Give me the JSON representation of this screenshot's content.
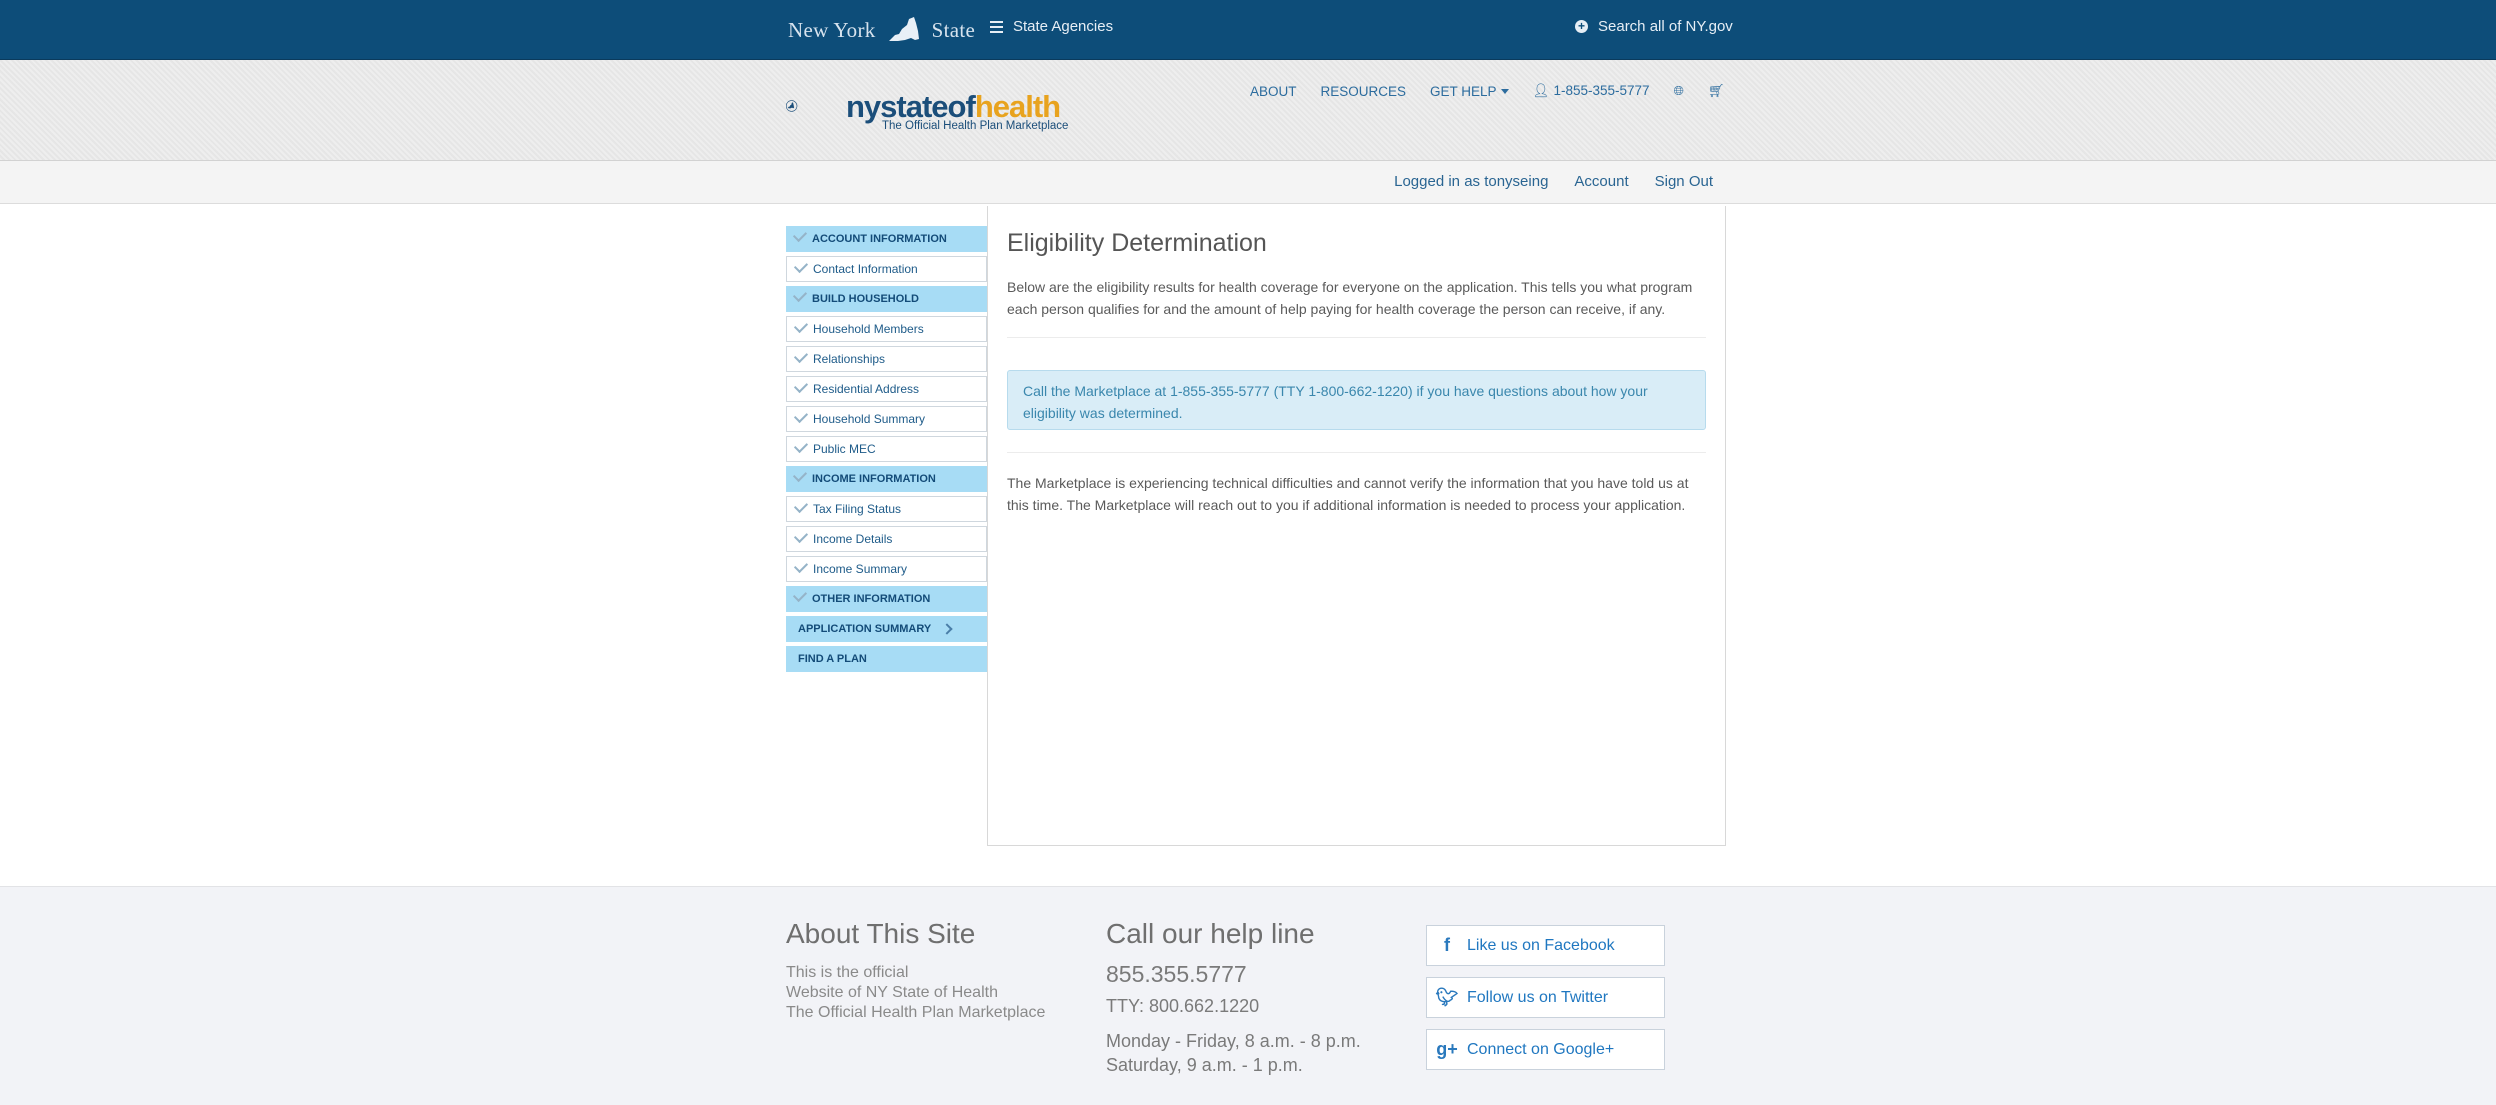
{
  "topbar": {
    "ny_left": "New York",
    "ny_right": "State",
    "agencies": "State Agencies",
    "search": "Search all of NY.gov"
  },
  "logo": {
    "name_part1": "nystateof",
    "name_part2": "health",
    "tagline": "The Official Health Plan Marketplace"
  },
  "nav": {
    "about": "ABOUT",
    "resources": "RESOURCES",
    "get_help": "GET HELP",
    "phone": "1-855-355-5777"
  },
  "account": {
    "logged_in": "Logged in as tonyseing",
    "account": "Account",
    "sign_out": "Sign Out"
  },
  "sidebar": {
    "items": [
      {
        "label": "ACCOUNT INFORMATION"
      },
      {
        "label": "Contact Information"
      },
      {
        "label": "BUILD HOUSEHOLD"
      },
      {
        "label": "Household Members"
      },
      {
        "label": "Relationships"
      },
      {
        "label": "Residential Address"
      },
      {
        "label": "Household Summary"
      },
      {
        "label": "Public MEC"
      },
      {
        "label": "INCOME INFORMATION"
      },
      {
        "label": "Tax Filing Status"
      },
      {
        "label": "Income Details"
      },
      {
        "label": "Income Summary"
      },
      {
        "label": "OTHER INFORMATION"
      },
      {
        "label": "APPLICATION SUMMARY"
      },
      {
        "label": "FIND A PLAN"
      }
    ]
  },
  "main": {
    "title": "Eligibility Determination",
    "intro": "Below are the eligibility results for health coverage for everyone on the application. This tells you what program each person qualifies for and the amount of help paying for health coverage the person can receive, if any.",
    "alert": "Call the Marketplace at 1-855-355-5777 (TTY 1-800-662-1220) if you have questions about how your eligibility was determined.",
    "note": "The Marketplace is experiencing technical difficulties and cannot verify the information that you have told us at this time. The Marketplace will reach out to you if additional information is needed to process your application."
  },
  "footer": {
    "about_title": "About This Site",
    "about_line1": "This is the official",
    "about_line2": "Website of NY State of Health",
    "about_line3": "The Official Health Plan Marketplace",
    "help_title": "Call our help line",
    "help_phone": "855.355.5777",
    "help_tty": "TTY: 800.662.1220",
    "hours1": "Monday - Friday, 8 a.m. - 8 p.m.",
    "hours2": "Saturday, 9 a.m. - 1 p.m.",
    "facebook": "Like us on Facebook",
    "twitter": "Follow us on Twitter",
    "google": "Connect on Google+"
  },
  "colors": {
    "topbar": "#0d4d79",
    "accent": "#2a6592",
    "sidebar_head": "#a7dcf5",
    "alert_bg": "#d9edf7",
    "logo_orange": "#e8a31e"
  }
}
